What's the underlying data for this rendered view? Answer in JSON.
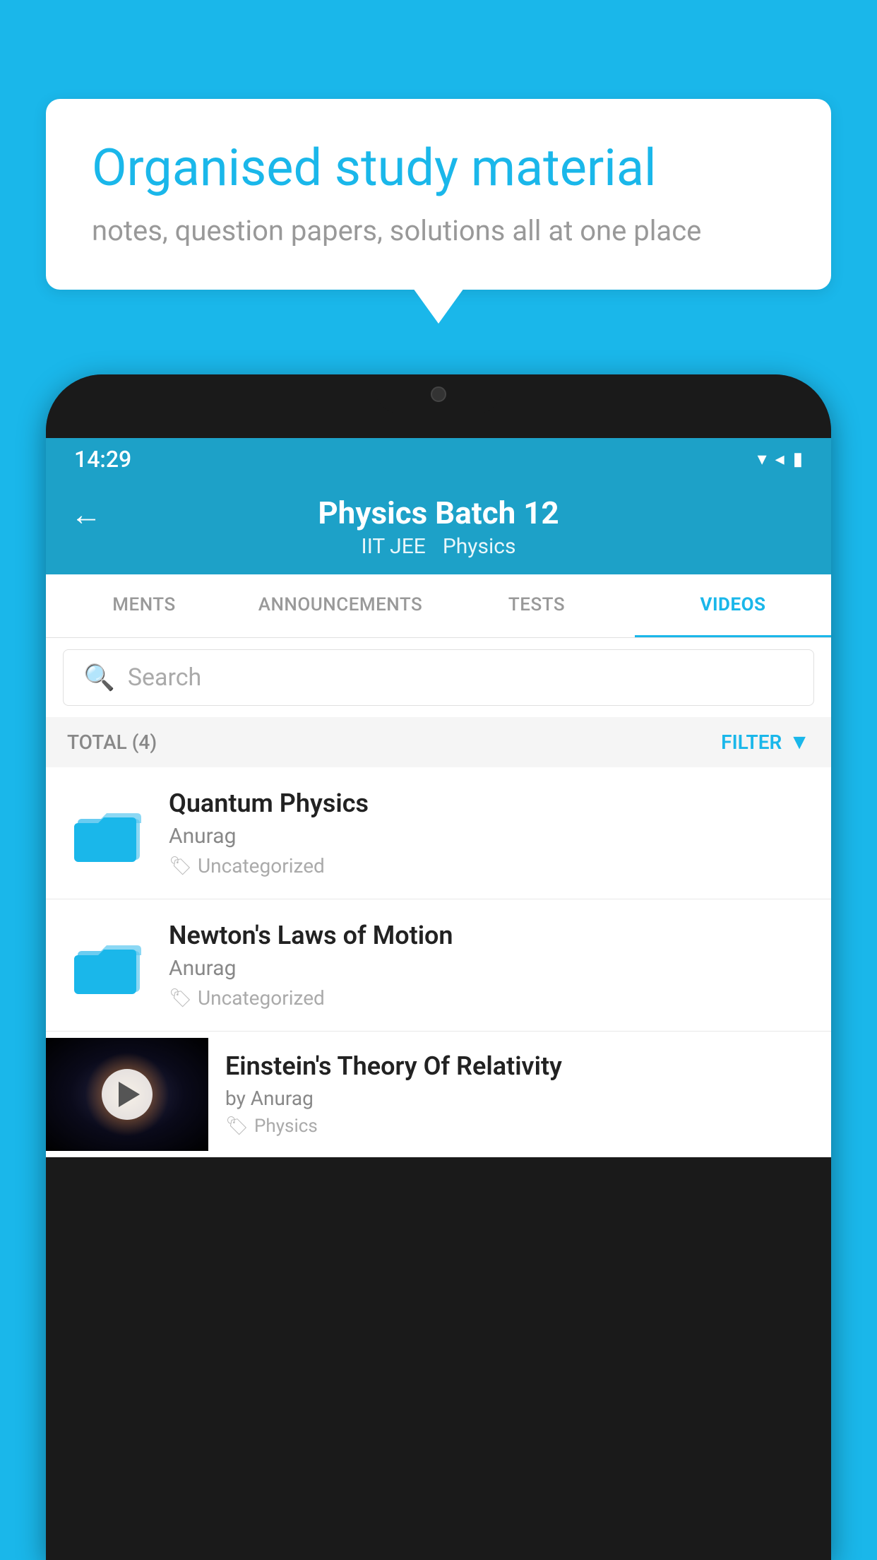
{
  "background_color": "#1ab7ea",
  "speech_bubble": {
    "title": "Organised study material",
    "subtitle": "notes, question papers, solutions all at one place"
  },
  "phone": {
    "status_bar": {
      "time": "14:29",
      "icons": [
        "wifi",
        "signal",
        "battery"
      ]
    },
    "app_bar": {
      "back_label": "←",
      "title": "Physics Batch 12",
      "subtitle_items": [
        "IIT JEE",
        "Physics"
      ]
    },
    "tabs": [
      {
        "label": "MENTS",
        "active": false
      },
      {
        "label": "ANNOUNCEMENTS",
        "active": false
      },
      {
        "label": "TESTS",
        "active": false
      },
      {
        "label": "VIDEOS",
        "active": true
      }
    ],
    "search": {
      "placeholder": "Search"
    },
    "filter_bar": {
      "total_label": "TOTAL (4)",
      "filter_label": "FILTER"
    },
    "videos": [
      {
        "id": 1,
        "title": "Quantum Physics",
        "author": "Anurag",
        "tag": "Uncategorized",
        "type": "folder"
      },
      {
        "id": 2,
        "title": "Newton's Laws of Motion",
        "author": "Anurag",
        "tag": "Uncategorized",
        "type": "folder"
      },
      {
        "id": 3,
        "title": "Einstein's Theory Of Relativity",
        "author": "by Anurag",
        "tag": "Physics",
        "type": "video"
      }
    ]
  }
}
